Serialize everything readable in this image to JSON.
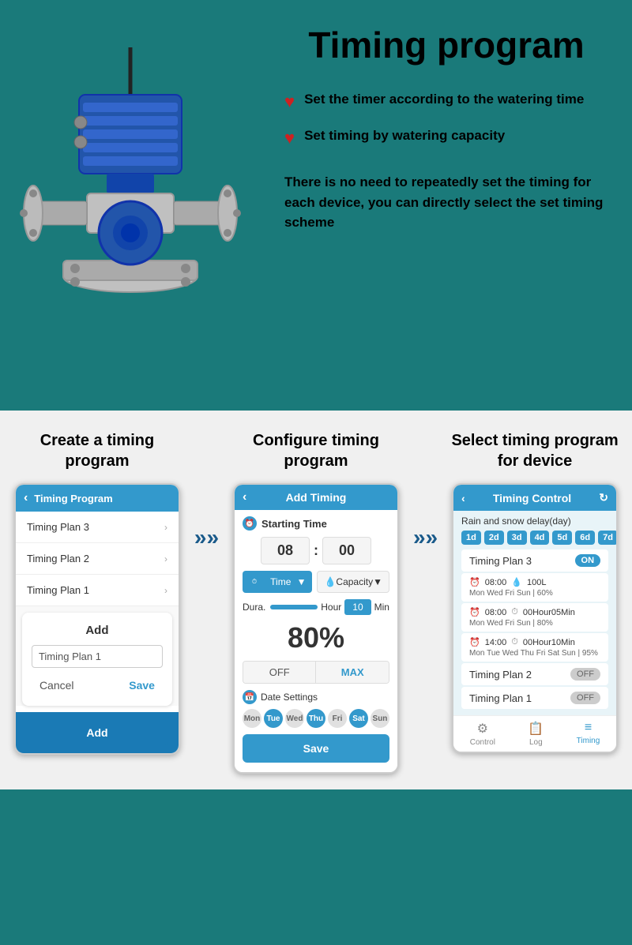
{
  "page": {
    "title": "Timing program",
    "background_color": "#1a7a7a"
  },
  "top_section": {
    "feature1": {
      "icon": "♥",
      "text": "Set the timer according to the watering time"
    },
    "feature2": {
      "icon": "♥",
      "text": "Set timing by watering capacity"
    },
    "description": "There is no need to repeatedly set the timing for each device, you can directly select the set timing scheme"
  },
  "bottom_section": {
    "col1": {
      "title": "Create a timing program",
      "phone": {
        "header": "Timing Program",
        "items": [
          "Timing Plan 3",
          "Timing Plan 2",
          "Timing Plan 1"
        ],
        "dialog": {
          "title": "Add",
          "input_value": "Timing Plan 1",
          "cancel": "Cancel",
          "save": "Save"
        },
        "footer_btn": "Add"
      }
    },
    "arrow1": "»»",
    "col2": {
      "title": "Configure timing program",
      "phone": {
        "header": "Add Timing",
        "starting_time_label": "Starting Time",
        "hour": "08",
        "minute": "00",
        "time_label": "Time",
        "capacity_label": "Capacity",
        "dura_label": "Dura.",
        "hour_label": "Hour",
        "min_value": "10",
        "min_label": "Min",
        "percent": "80%",
        "off_label": "OFF",
        "max_label": "MAX",
        "date_settings_label": "Date Settings",
        "days": [
          {
            "label": "Mon",
            "active": false
          },
          {
            "label": "Tue",
            "active": true
          },
          {
            "label": "Wed",
            "active": false
          },
          {
            "label": "Thu",
            "active": true
          },
          {
            "label": "Fri",
            "active": false
          },
          {
            "label": "Sat",
            "active": true
          },
          {
            "label": "Sun",
            "active": false
          }
        ],
        "save_btn": "Save"
      }
    },
    "arrow2": "»»",
    "col3": {
      "title": "Select timing program for device",
      "phone": {
        "header": "Timing Control",
        "rain_delay": "Rain and snow delay(day)",
        "day_options": [
          "1d",
          "2d",
          "3d",
          "4d",
          "5d",
          "6d",
          "7d"
        ],
        "plans": [
          {
            "name": "Timing Plan 3",
            "toggle": "ON",
            "active": true,
            "schedules": [
              {
                "time": "08:00",
                "capacity": "100L",
                "days": "Mon Wed Fri Sun | 60%"
              },
              {
                "time": "08:00",
                "capacity": "00Hour05Min",
                "days": "Mon Wed Fri Sun | 80%"
              },
              {
                "time": "14:00",
                "capacity": "00Hour10Min",
                "days": "Mon Tue Wed Thu Fri Sat Sun | 95%"
              }
            ]
          },
          {
            "name": "Timing Plan 2",
            "toggle": "OFF",
            "active": false
          },
          {
            "name": "Timing Plan 1",
            "toggle": "OFF",
            "active": false
          }
        ],
        "nav": [
          {
            "label": "Control",
            "icon": "⚙",
            "active": false
          },
          {
            "label": "Log",
            "icon": "📋",
            "active": false
          },
          {
            "label": "Timing",
            "icon": "≡",
            "active": true
          }
        ]
      }
    }
  }
}
